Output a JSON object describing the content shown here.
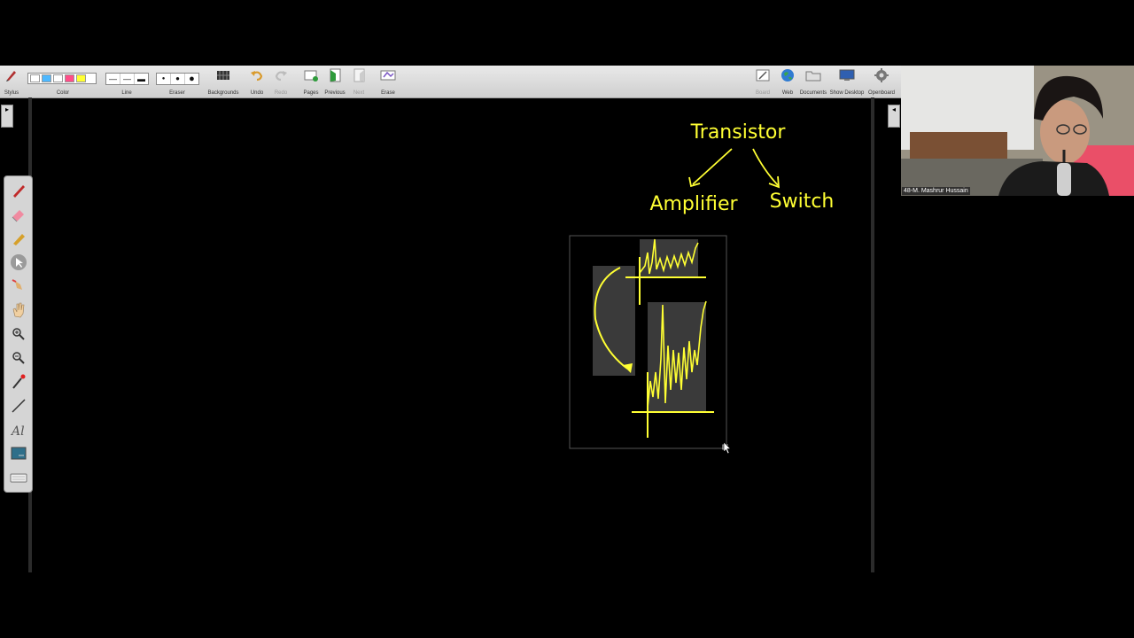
{
  "toolbar": {
    "stylus": "Stylus",
    "color": "Color",
    "line": "Line",
    "eraser": "Eraser",
    "backgrounds": "Backgrounds",
    "undo": "Undo",
    "redo": "Redo",
    "pages": "Pages",
    "previous": "Previous",
    "next": "Next",
    "erase": "Erase",
    "board": "Board",
    "web": "Web",
    "documents": "Documents",
    "show_desktop": "Show Desktop",
    "openboard": "Openboard",
    "colors": [
      "#ffffff",
      "#4db8ff",
      "#ffffff",
      "#ff4d88",
      "#ffff33"
    ]
  },
  "board": {
    "title": "Transistor",
    "branch_left": "Amplifier",
    "branch_right": "Switch",
    "ink_color": "#ffff33"
  },
  "webcam": {
    "participant": "48-M. Mashrur Hussain"
  }
}
